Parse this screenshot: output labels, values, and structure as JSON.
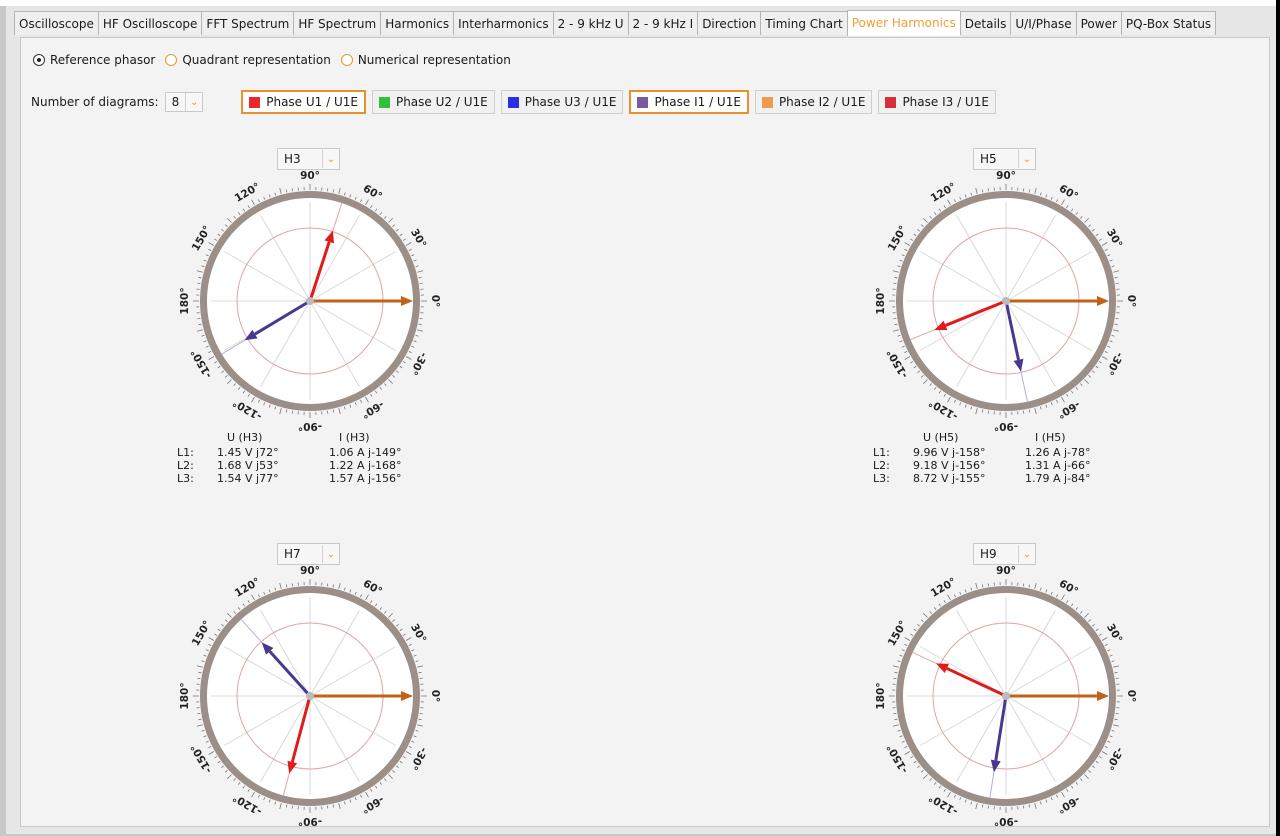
{
  "tabs": [
    {
      "label": "Oscilloscope",
      "active": false
    },
    {
      "label": "HF Oscilloscope",
      "active": false
    },
    {
      "label": "FFT Spectrum",
      "active": false
    },
    {
      "label": "HF Spectrum",
      "active": false
    },
    {
      "label": "Harmonics",
      "active": false
    },
    {
      "label": "Interharmonics",
      "active": false
    },
    {
      "label": "2 - 9 kHz U",
      "active": false
    },
    {
      "label": "2 - 9 kHz I",
      "active": false
    },
    {
      "label": "Direction",
      "active": false
    },
    {
      "label": "Timing Chart",
      "active": false
    },
    {
      "label": "Power Harmonics",
      "active": true
    },
    {
      "label": "Details",
      "active": false
    },
    {
      "label": "U/I/Phase",
      "active": false
    },
    {
      "label": "Power",
      "active": false
    },
    {
      "label": "PQ-Box Status",
      "active": false
    }
  ],
  "view_mode": {
    "options": [
      {
        "label": "Reference phasor",
        "checked": true
      },
      {
        "label": "Quadrant representation",
        "checked": false
      },
      {
        "label": "Numerical representation",
        "checked": false
      }
    ]
  },
  "diagram_count": {
    "label": "Number of diagrams:",
    "value": "8"
  },
  "phases": [
    {
      "label": "Phase U1 / U1E",
      "color": "#e8282d",
      "selected": true
    },
    {
      "label": "Phase U2 / U1E",
      "color": "#2ec13a",
      "selected": false
    },
    {
      "label": "Phase U3 / U1E",
      "color": "#2a2fe6",
      "selected": false
    },
    {
      "label": "Phase I1 / U1E",
      "color": "#7a5aa0",
      "selected": true
    },
    {
      "label": "Phase I2 / U1E",
      "color": "#ee9a50",
      "selected": false
    },
    {
      "label": "Phase I3 / U1E",
      "color": "#d92f3a",
      "selected": false
    }
  ],
  "colors": {
    "reference": "#c2621a",
    "voltage": "#e01b1b",
    "current": "#4a3790",
    "ring": "#9c8f87",
    "inner_circle": "#e4a3a3",
    "accent": "#e8912c"
  },
  "dial_labels": [
    "90°",
    "60°",
    "30°",
    "0°",
    "-30°",
    "-60°",
    "-90°",
    "-120°",
    "-150°",
    "180°",
    "150°",
    "120°"
  ],
  "readout_rows": [
    "L1:",
    "L2:",
    "L3:"
  ],
  "diagrams": [
    {
      "harmonic": "H3",
      "u_header": "U (H3)",
      "i_header": "I (H3)",
      "u_values": [
        "1.45 V j72°",
        "1.68 V j53°",
        "1.54 V j77°"
      ],
      "i_values": [
        "1.06 A j-149°",
        "1.22 A j-168°",
        "1.57 A j-156°"
      ],
      "vectors": {
        "reference": {
          "angle": 0,
          "mag": 1.0
        },
        "voltage": {
          "angle": 72,
          "mag": 0.72
        },
        "current": {
          "angle": -149,
          "mag": 0.74
        }
      }
    },
    {
      "harmonic": "H5",
      "u_header": "U (H5)",
      "i_header": "I (H5)",
      "u_values": [
        "9.96 V j-158°",
        "9.18 V j-156°",
        "8.72 V j-155°"
      ],
      "i_values": [
        "1.26 A j-78°",
        "1.31 A j-66°",
        "1.79 A j-84°"
      ],
      "vectors": {
        "reference": {
          "angle": 0,
          "mag": 1.0
        },
        "voltage": {
          "angle": -158,
          "mag": 0.75
        },
        "current": {
          "angle": -78,
          "mag": 0.7
        }
      }
    },
    {
      "harmonic": "H7",
      "u_header": "",
      "i_header": "",
      "u_values": [],
      "i_values": [],
      "vectors": {
        "reference": {
          "angle": 0,
          "mag": 1.0
        },
        "voltage": {
          "angle": -105,
          "mag": 0.78
        },
        "current": {
          "angle": 132,
          "mag": 0.7
        }
      }
    },
    {
      "harmonic": "H9",
      "u_header": "",
      "i_header": "",
      "u_values": [],
      "i_values": [],
      "vectors": {
        "reference": {
          "angle": 0,
          "mag": 1.0
        },
        "voltage": {
          "angle": 155,
          "mag": 0.75
        },
        "current": {
          "angle": -99,
          "mag": 0.75
        }
      }
    }
  ]
}
